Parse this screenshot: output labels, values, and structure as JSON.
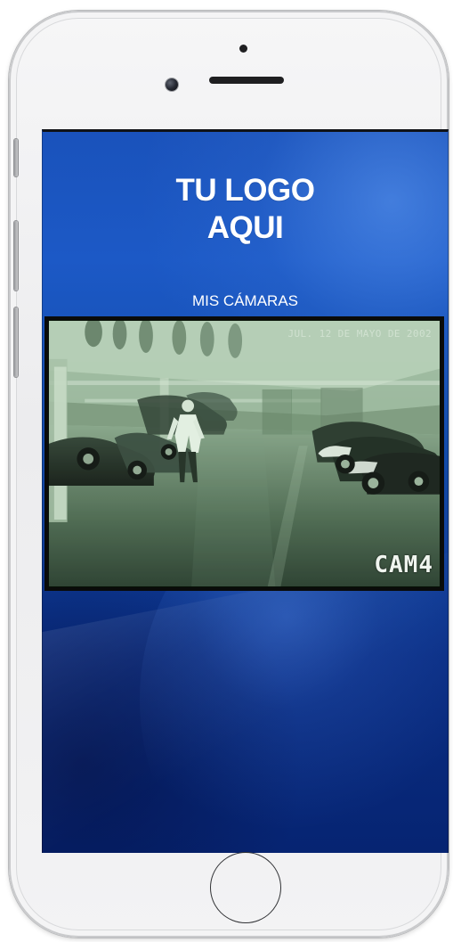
{
  "hero": {
    "title_line_1": "TU LOGO",
    "title_line_2": "AQUI"
  },
  "section": {
    "label": "MIS CÁMARAS"
  },
  "camera": {
    "timestamp": "JUL. 12 DE MAYO DE 2002",
    "label": "CAM4"
  },
  "colors": {
    "screen_blue": "#1a52bb",
    "screen_navy": "#062472",
    "camera_tint": "#d6e7d4",
    "phone_silver": "#f0f0f2",
    "text_white": "#ffffff"
  },
  "icons": {
    "speaker": "speaker-icon",
    "front_camera": "front-camera-icon",
    "sensor": "sensor-dot-icon",
    "home": "home-button"
  }
}
